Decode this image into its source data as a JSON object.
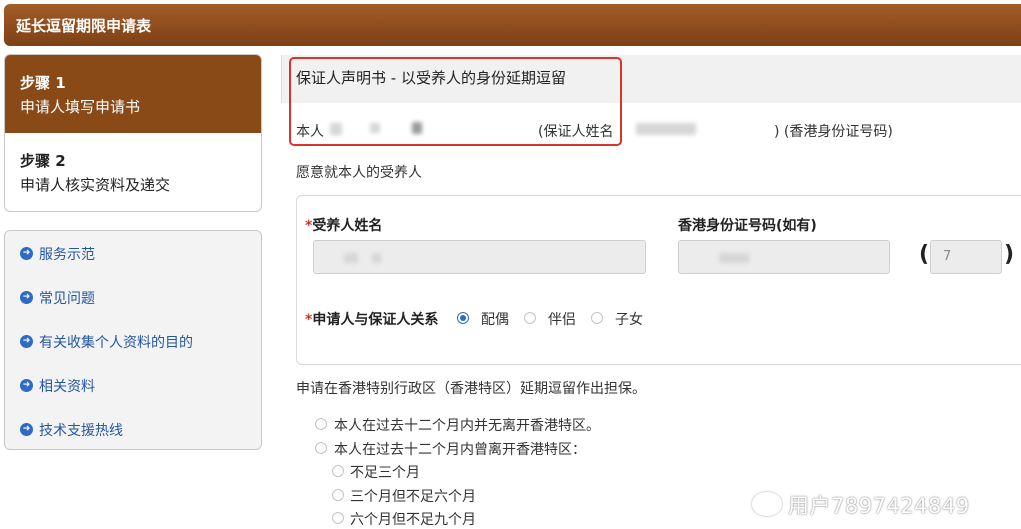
{
  "header": {
    "title": "延长逗留期限申请表"
  },
  "steps": [
    {
      "num": "步骤 1",
      "label": "申请人填写申请书"
    },
    {
      "num": "步骤 2",
      "label": "申请人核实资料及递交"
    }
  ],
  "links": [
    {
      "label": "服务示范"
    },
    {
      "label": "常见问题"
    },
    {
      "label": "有关收集个人资料的目的"
    },
    {
      "label": "相关资料"
    },
    {
      "label": "技术支援热线"
    }
  ],
  "section": {
    "title": "保证人声明书 - 以受养人的身份延期逗留"
  },
  "declaration": {
    "prefix": "本人",
    "guarantor_name_label": "(保证人姓名",
    "id_suffix": ") (香港身份证号码)",
    "line2": "愿意就本人的受养人"
  },
  "dependant": {
    "name_label": "受养人姓名",
    "id_label": "香港身份证号码(如有)",
    "check_digit": "7",
    "relation_label": "申请人与保证人关系",
    "relations": [
      {
        "label": "配偶",
        "selected": true
      },
      {
        "label": "伴侣",
        "selected": false
      },
      {
        "label": "子女",
        "selected": false
      }
    ]
  },
  "guarantee_text": "申请在香港特别行政区（香港特区）延期逗留作出担保。",
  "options": [
    {
      "label": "本人在过去十二个月内并无离开香港特区。"
    },
    {
      "label": "本人在过去十二个月内曾离开香港特区："
    }
  ],
  "sub_options": [
    {
      "label": "不足三个月"
    },
    {
      "label": "三个月但不足六个月"
    },
    {
      "label": "六个月但不足九个月"
    }
  ],
  "watermark": "用户7897424849"
}
